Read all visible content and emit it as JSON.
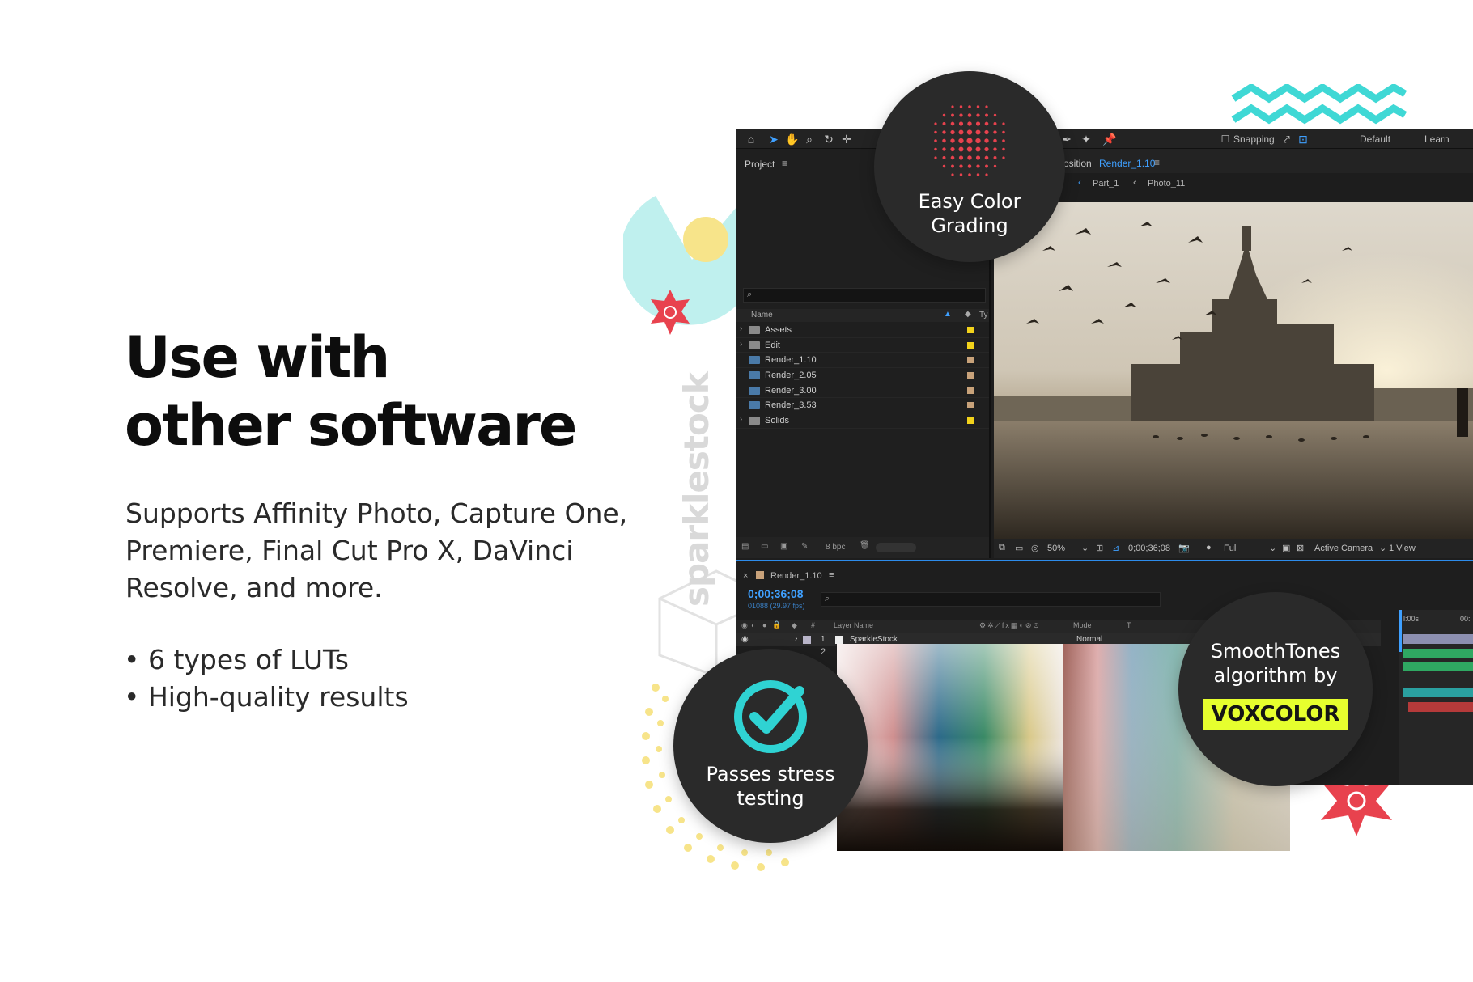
{
  "headline": {
    "line1": "Use with",
    "line2": "other software"
  },
  "description": "Supports Affinity Photo, Capture One, Premiere, Final Cut Pro X, DaVinci Resolve, and more.",
  "bullets": [
    "• 6 types of LUTs",
    "• High-quality results"
  ],
  "watermark": "sparklestock",
  "badges": {
    "color_grading": "Easy Color\nGrading",
    "stress": "Passes stress\ntesting",
    "smoothtones": "SmoothTones\nalgorithm by",
    "vox_logo": "VOXCOLOR"
  },
  "app": {
    "toolbar": {
      "snapping": "Snapping",
      "workspace_default": "Default",
      "workspace_learn": "Learn"
    },
    "project": {
      "title": "Project",
      "column_name": "Name",
      "column_type": "Ty",
      "items": [
        {
          "name": "Assets",
          "kind": "folder",
          "color": "#f2d21b"
        },
        {
          "name": "Edit",
          "kind": "folder",
          "color": "#f2d21b"
        },
        {
          "name": "Render_1.10",
          "kind": "comp",
          "color": "#c8a27a"
        },
        {
          "name": "Render_2.05",
          "kind": "comp",
          "color": "#c8a27a"
        },
        {
          "name": "Render_3.00",
          "kind": "comp",
          "color": "#c8a27a"
        },
        {
          "name": "Render_3.53",
          "kind": "comp",
          "color": "#c8a27a"
        },
        {
          "name": "Solids",
          "kind": "folder",
          "color": "#f2d21b"
        }
      ],
      "bpc": "8 bpc"
    },
    "composition": {
      "tab_prefix": "osition",
      "tab_comp": "Render_1.10",
      "crumb1": "Part_1",
      "crumb2": "Photo_11"
    },
    "viewer_footer": {
      "zoom": "50%",
      "timecode": "0;00;36;08",
      "resolution": "Full",
      "camera": "Active Camera",
      "views": "1 View"
    },
    "timeline": {
      "comp_tab": "Render_1.10",
      "timecode": "0;00;36;08",
      "frame_info": "01088 (29.97 fps)",
      "col_hash": "#",
      "col_layer_name": "Layer Name",
      "col_mode": "Mode",
      "col_t": "T",
      "layer_1_index": "1",
      "layer_1_name": "SparkleStock",
      "layer_1_mode": "Normal",
      "layer_2_index": "2",
      "ruler_start": "l:00s",
      "ruler_next": "00:"
    }
  },
  "colors": {
    "accent_blue": "#2d8ceb",
    "badge_bg": "#2a2a2a",
    "vox_yellow": "#e6ff2e",
    "check_teal": "#2fd3d3",
    "dots_red": "#e8424e",
    "zigzag_teal": "#3fd8d5",
    "star_red": "#e8424e"
  }
}
